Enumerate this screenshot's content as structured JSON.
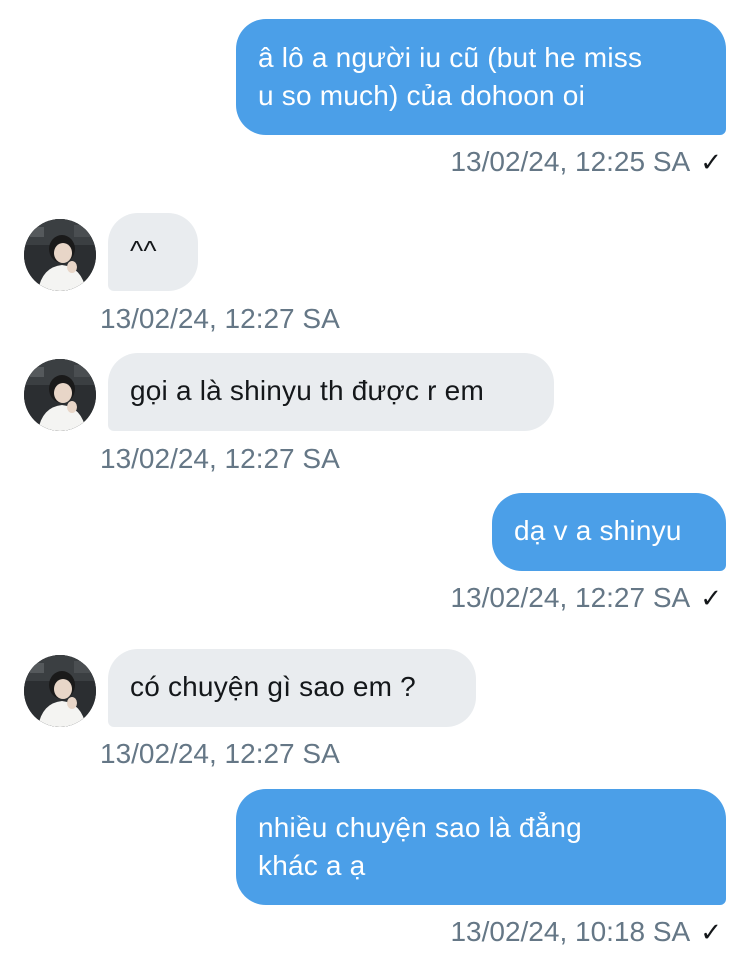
{
  "messages": [
    {
      "direction": "out",
      "text_lines": [
        "â lô a người iu cũ (but he miss",
        "u so much) của dohoon oi"
      ],
      "timestamp": "13/02/24, 12:25 SA",
      "status_icon": "checkmark-icon"
    },
    {
      "direction": "in",
      "text_lines": [
        "^^"
      ],
      "timestamp": "13/02/24, 12:27 SA"
    },
    {
      "direction": "in",
      "text_lines": [
        "gọi a là shinyu th được r em"
      ],
      "timestamp": "13/02/24, 12:27 SA"
    },
    {
      "direction": "out",
      "text_lines": [
        "dạ v a shinyu"
      ],
      "timestamp": "13/02/24, 12:27 SA",
      "status_icon": "checkmark-icon"
    },
    {
      "direction": "in",
      "text_lines": [
        "có chuyện gì sao em ?"
      ],
      "timestamp": "13/02/24, 12:27 SA"
    },
    {
      "direction": "out",
      "text_lines": [
        "nhiều chuyện sao là đẳng",
        "khác a ạ"
      ],
      "timestamp": "13/02/24, 10:18 SA",
      "status_icon": "checkmark-icon"
    }
  ],
  "check_glyph": "✓",
  "colors": {
    "outgoing_bubble": "#4b9fe8",
    "incoming_bubble": "#e9ecef",
    "timestamp": "#657786",
    "background": "#ffffff"
  }
}
